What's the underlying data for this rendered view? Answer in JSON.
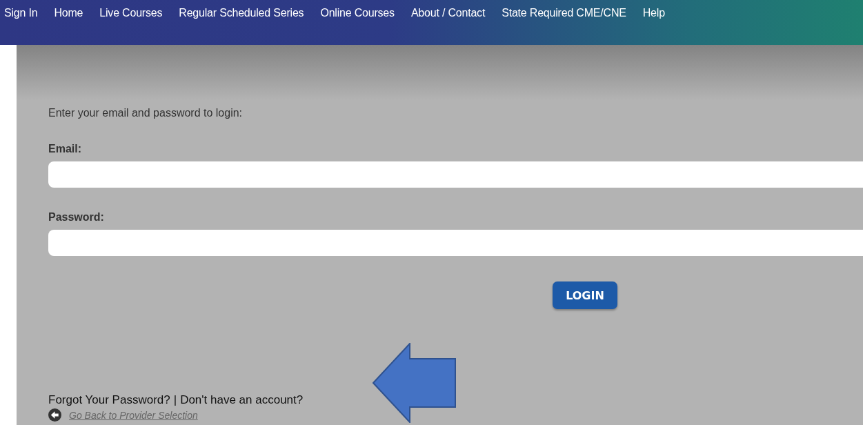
{
  "nav": {
    "items": [
      {
        "label": "Sign In"
      },
      {
        "label": "Home"
      },
      {
        "label": "Live Courses"
      },
      {
        "label": "Regular Scheduled Series"
      },
      {
        "label": "Online Courses"
      },
      {
        "label": "About / Contact"
      },
      {
        "label": "State Required CME/CNE"
      },
      {
        "label": "Help"
      }
    ]
  },
  "login": {
    "instructions": "Enter your email and password to login:",
    "fields": [
      {
        "label": "Email:"
      },
      {
        "label": "Password:"
      }
    ],
    "button": "LOGIN",
    "links": {
      "forgot": "Forgot Your Password?",
      "separator": "|",
      "signup": "Don't have an account?",
      "back": "Go Back to Provider Selection"
    }
  },
  "annotation": {
    "kind": "arrow"
  }
}
